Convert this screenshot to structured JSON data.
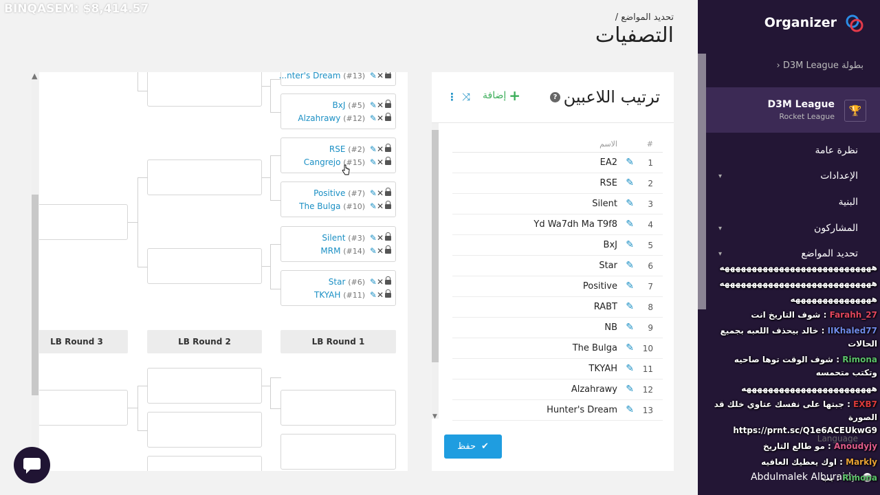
{
  "overlay": {
    "text": "BINQASEM: $8,414.57"
  },
  "header": {
    "breadcrumb": "تحديد المواضع /",
    "title": "التصفيات"
  },
  "bracket": {
    "round_labels": [
      "LB Round 3",
      "LB Round 2",
      "LB Round 1"
    ],
    "matches": [
      {
        "top": {
          "name": "...nter's Dream",
          "seed": "(#13)"
        }
      },
      {
        "top": {
          "name": "BxJ",
          "seed": "(#5)"
        },
        "bottom": {
          "name": "Alzahrawy",
          "seed": "(#12)"
        }
      },
      {
        "top": {
          "name": "RSE",
          "seed": "(#2)"
        },
        "bottom": {
          "name": "Cangrejo",
          "seed": "(#15)"
        }
      },
      {
        "top": {
          "name": "Positive",
          "seed": "(#7)"
        },
        "bottom": {
          "name": "The Bulga",
          "seed": "(#10)"
        }
      },
      {
        "top": {
          "name": "Silent",
          "seed": "(#3)"
        },
        "bottom": {
          "name": "MRM",
          "seed": "(#14)"
        }
      },
      {
        "top": {
          "name": "Star",
          "seed": "(#6)"
        },
        "bottom": {
          "name": "TKYAH",
          "seed": "(#11)"
        }
      }
    ]
  },
  "seeding": {
    "title": "ترتيب اللاعبين",
    "help": "?",
    "add_label": "إضافة",
    "col_num": "#",
    "col_name": "الاسم",
    "rows": [
      {
        "num": "1",
        "name": "EA2"
      },
      {
        "num": "2",
        "name": "RSE"
      },
      {
        "num": "3",
        "name": "Silent"
      },
      {
        "num": "4",
        "name": "Yd Wa7dh Ma T9f8"
      },
      {
        "num": "5",
        "name": "BxJ"
      },
      {
        "num": "6",
        "name": "Star"
      },
      {
        "num": "7",
        "name": "Positive"
      },
      {
        "num": "8",
        "name": "RABT"
      },
      {
        "num": "9",
        "name": "NB"
      },
      {
        "num": "10",
        "name": "The Bulga"
      },
      {
        "num": "11",
        "name": "TKYAH"
      },
      {
        "num": "12",
        "name": "Alzahrawy"
      },
      {
        "num": "13",
        "name": "Hunter's Dream"
      }
    ],
    "save_label": "حفظ"
  },
  "sidebar": {
    "logo": "Organizer",
    "back": "بطولة D3M League",
    "tournament_name": "D3M League",
    "tournament_game": "Rocket League",
    "nav": [
      "نظرة عامة",
      "الإعدادات",
      "البنية",
      "المشاركون",
      "تحديد المواضع"
    ],
    "language": "Language",
    "user": "Abdulmalek Alburaidy"
  },
  "chat": [
    {
      "user": "",
      "text": "ههههههههههههههههههههههههههههه"
    },
    {
      "user": "",
      "text": "ههههههههههههههههههههههههههههه"
    },
    {
      "user": "",
      "text": "هههههههههههههههه"
    },
    {
      "user": "Farahh_27",
      "text": "شوف التاريخ انت",
      "color": "#e0455c"
    },
    {
      "user": "IIKhaled77",
      "text": "خالد بيحذف اللعبه بجميع الحالات",
      "color": "#6f8ae8"
    },
    {
      "user": "Rimona",
      "text": "شوف الوقت توها صاحيه وتكتب متحمسه",
      "color": "#5bc26a"
    },
    {
      "user": "",
      "text": "ههههههههههههههههههههههههه"
    },
    {
      "user": "EXB7",
      "text": "جبتها على نفسك عتاوي خلك قد الصورة https://prnt.sc/Q1e6ACEUkwG9",
      "color": "#d83a3a"
    },
    {
      "user": "Anoudyjy",
      "text": "مو طالع التاريخ",
      "color": "#e05b8a"
    },
    {
      "user": "Markly",
      "text": "اوك يعطيك العافيه",
      "color": "#e8a233"
    },
    {
      "user": "Rimona",
      "text": "بب",
      "color": "#5bc26a"
    }
  ]
}
